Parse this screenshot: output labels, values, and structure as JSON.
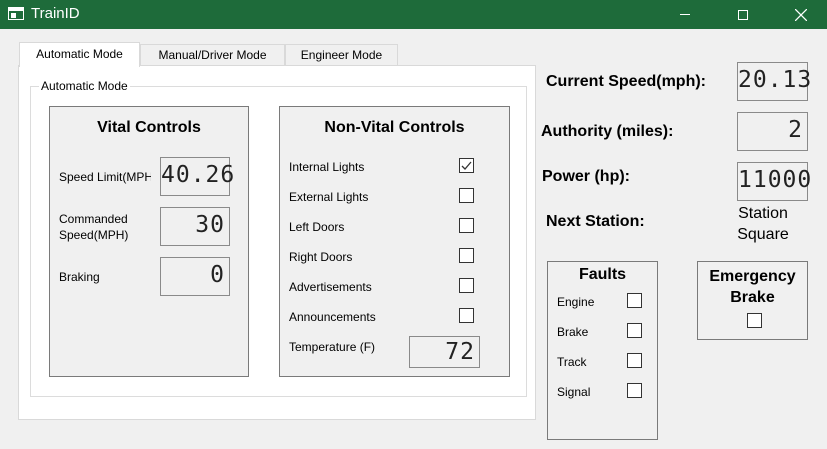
{
  "window": {
    "title": "TrainID"
  },
  "tabs": [
    "Automatic Mode",
    "Manual/Driver Mode",
    "Engineer Mode"
  ],
  "automatic_mode": {
    "group_title": "Automatic Mode",
    "vital": {
      "title": "Vital Controls",
      "speed_limit_label": "Speed Limit(MPH",
      "speed_limit_value": "40.26",
      "commanded_speed_label_1": "Commanded",
      "commanded_speed_label_2": "Speed(MPH)",
      "commanded_speed_value": "30",
      "braking_label": "Braking",
      "braking_value": "0"
    },
    "non_vital": {
      "title": "Non-Vital Controls",
      "items": [
        {
          "label": "Internal Lights",
          "checked": true
        },
        {
          "label": "External Lights",
          "checked": false
        },
        {
          "label": "Left Doors",
          "checked": false
        },
        {
          "label": "Right Doors",
          "checked": false
        },
        {
          "label": "Advertisements",
          "checked": false
        },
        {
          "label": "Announcements",
          "checked": false
        }
      ],
      "temperature_label": "Temperature (F)",
      "temperature_value": "72"
    }
  },
  "status": {
    "current_speed_label": "Current Speed(mph):",
    "current_speed_value": "20.13",
    "authority_label": "Authority (miles):",
    "authority_value": "2",
    "power_label": "Power (hp):",
    "power_value": "11000",
    "next_station_label": "Next Station:",
    "next_station_line1": "Station",
    "next_station_line2": "Square"
  },
  "faults": {
    "title": "Faults",
    "items": [
      {
        "label": "Engine",
        "checked": false
      },
      {
        "label": "Brake",
        "checked": false
      },
      {
        "label": "Track",
        "checked": false
      },
      {
        "label": "Signal",
        "checked": false
      }
    ]
  },
  "emergency_brake": {
    "title_line1": "Emergency",
    "title_line2": "Brake",
    "checked": false
  }
}
